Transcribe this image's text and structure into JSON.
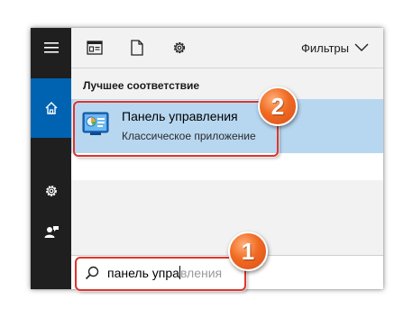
{
  "topbar": {
    "filters_label": "Фильтры",
    "icons": [
      "documents-icon",
      "file-icon",
      "settings-gear-icon",
      "chevron-down-icon"
    ]
  },
  "sidebar": {
    "items": [
      {
        "icon": "hamburger-menu-icon",
        "active": false
      },
      {
        "icon": "home-icon",
        "active": true
      },
      {
        "icon": "settings-gear-icon",
        "active": false
      },
      {
        "icon": "user-feedback-icon",
        "active": false
      }
    ]
  },
  "results": {
    "section_title": "Лучшее соответствие",
    "best_match": {
      "title": "Панель управления",
      "subtitle": "Классическое приложение",
      "icon": "control-panel-icon"
    }
  },
  "search": {
    "typed": "панель упра",
    "suggestion": "вления"
  },
  "annotations": {
    "badge_1": "1",
    "badge_2": "2",
    "color": "#e0342a",
    "badge_color": "#f06a22"
  },
  "colors": {
    "sidebar_bg": "#1f1f1f",
    "active_accent": "#0063b1",
    "selection_bg": "#b7d7f1"
  }
}
